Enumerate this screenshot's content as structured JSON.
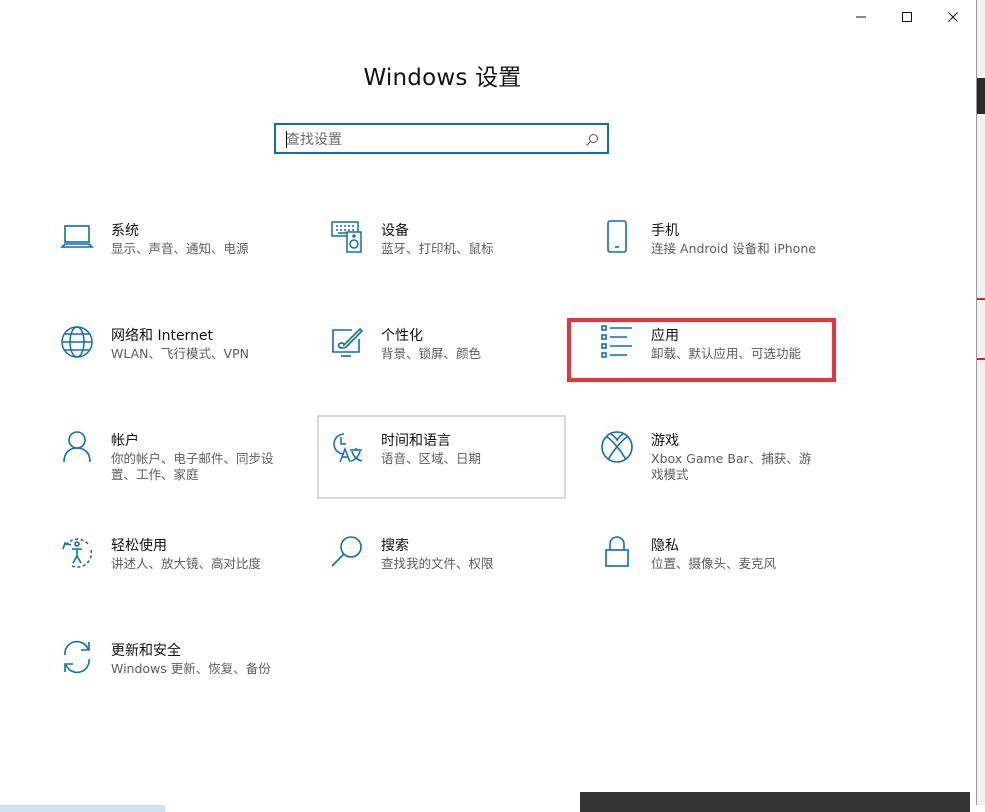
{
  "window": {
    "title": "Windows 设置",
    "controls": {
      "minimize": "minimize",
      "maximize": "maximize",
      "close": "close"
    }
  },
  "search": {
    "placeholder": "查找设置",
    "value": ""
  },
  "tiles": [
    {
      "icon": "laptop-icon",
      "name": "系统",
      "desc": "显示、声音、通知、电源"
    },
    {
      "icon": "devices-icon",
      "name": "设备",
      "desc": "蓝牙、打印机、鼠标"
    },
    {
      "icon": "phone-icon",
      "name": "手机",
      "desc": "连接 Android 设备和 iPhone"
    },
    {
      "icon": "globe-icon",
      "name": "网络和 Internet",
      "desc": "WLAN、飞行模式、VPN"
    },
    {
      "icon": "personalization-icon",
      "name": "个性化",
      "desc": "背景、锁屏、颜色"
    },
    {
      "icon": "apps-list-icon",
      "name": "应用",
      "desc": "卸载、默认应用、可选功能"
    },
    {
      "icon": "person-icon",
      "name": "帐户",
      "desc": "你的帐户、电子邮件、同步设置、工作、家庭"
    },
    {
      "icon": "time-language-icon",
      "name": "时间和语言",
      "desc": "语音、区域、日期"
    },
    {
      "icon": "xbox-icon",
      "name": "游戏",
      "desc": "Xbox Game Bar、捕获、游戏模式"
    },
    {
      "icon": "ease-of-access-icon",
      "name": "轻松使用",
      "desc": "讲述人、放大镜、高对比度"
    },
    {
      "icon": "search-icon",
      "name": "搜索",
      "desc": "查找我的文件、权限"
    },
    {
      "icon": "lock-icon",
      "name": "隐私",
      "desc": "位置、摄像头、麦克风"
    },
    {
      "icon": "sync-icon",
      "name": "更新和安全",
      "desc": "Windows 更新、恢复、备份"
    }
  ],
  "colors": {
    "accent": "#0f6cbd",
    "highlight": "#e8323c"
  }
}
